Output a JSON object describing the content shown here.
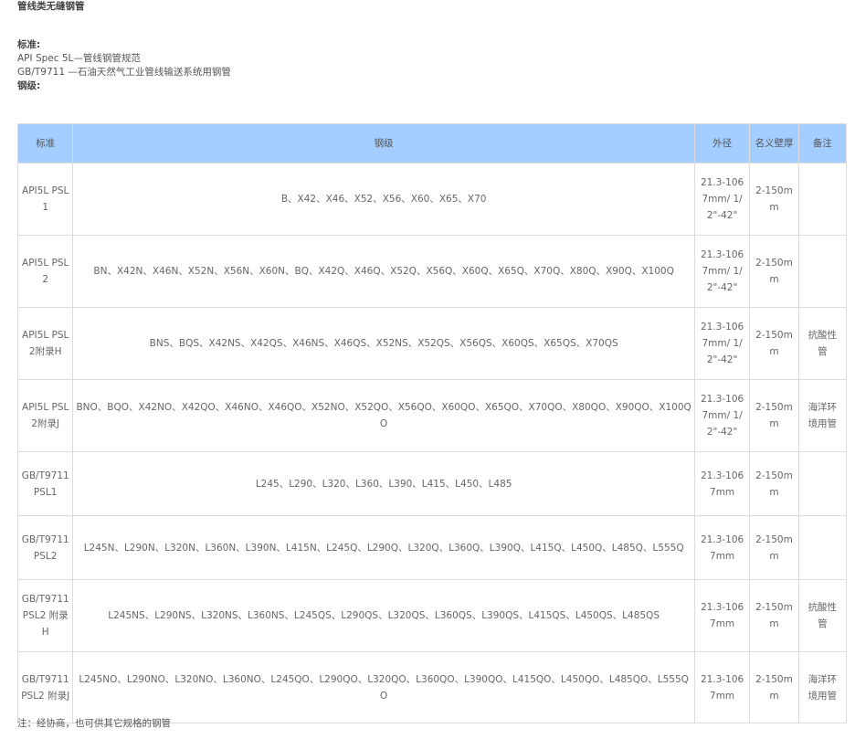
{
  "page": {
    "title": "管线类无缝钢管",
    "standard_label": "标准:",
    "standards": [
      "API Spec 5L—管线钢管规范",
      "GB/T9711 —石油天然气工业管线输送系统用钢管"
    ],
    "grade_label": "钢级:"
  },
  "table": {
    "headers": [
      "标准",
      "钢级",
      "外径",
      "名义壁厚",
      "备注"
    ],
    "rows": [
      {
        "std": "API5L PSL1",
        "grade": "B、X42、X46、X52、X56、X60、X65、X70",
        "od": "21.3-1067mm/ 1/2\"-42\"",
        "wt": "2-150mm",
        "note": ""
      },
      {
        "std": "API5L PSL2",
        "grade": "BN、X42N、X46N、X52N、X56N、X60N、BQ、X42Q、X46Q、X52Q、X56Q、X60Q、X65Q、X70Q、X80Q、X90Q、X100Q",
        "od": "21.3-1067mm/ 1/2\"-42\"",
        "wt": "2-150mm",
        "note": ""
      },
      {
        "std": "API5L PSL2附录H",
        "grade": "BNS、BQS、X42NS、X42QS、X46NS、X46QS、X52NS、X52QS、X56QS、X60QS、X65QS、X70QS",
        "od": "21.3-1067mm/ 1/2\"-42\"",
        "wt": "2-150mm",
        "note": "抗酸性管"
      },
      {
        "std": "API5L PSL2附录J",
        "grade": "BNO、BQO、X42NO、X42QO、X46NO、X46QO、X52NO、X52QO、X56QO、X60QO、X65QO、X70QO、X80QO、X90QO、X100QO",
        "od": "21.3-1067mm/ 1/2\"-42\"",
        "wt": "2-150mm",
        "note": "海洋环境用管"
      },
      {
        "std": "GB/T9711 PSL1",
        "grade": "L245、L290、L320、L360、L390、L415、L450、L485",
        "od": "21.3-1067mm",
        "wt": "2-150mm",
        "note": ""
      },
      {
        "std": "GB/T9711 PSL2",
        "grade": "L245N、L290N、L320N、L360N、L390N、L415N、L245Q、L290Q、L320Q、L360Q、L390Q、L415Q、L450Q、L485Q、L555Q",
        "od": "21.3-1067mm",
        "wt": "2-150mm",
        "note": ""
      },
      {
        "std": "GB/T9711 PSL2 附录H",
        "grade": "L245NS、L290NS、L320NS、L360NS、L245QS、L290QS、L320QS、L360QS、L390QS、L415QS、L450QS、L485QS",
        "od": "21.3-1067mm",
        "wt": "2-150mm",
        "note": "抗酸性管"
      },
      {
        "std": "GB/T9711 PSL2 附录J",
        "grade": "L245NO、L290NO、L320NO、L360NO、L245QO、L290QO、L320QO、L360QO、L390QO、L415QO、L450QO、L485QO、L555QO",
        "od": "21.3-1067mm",
        "wt": "2-150mm",
        "note": "海洋环境用管"
      }
    ]
  },
  "footnote": "注：经协商，也可供其它规格的钢管",
  "colors": {
    "header_bg": "#a3ceff",
    "border": "#dcdcdc",
    "text": "#666666"
  }
}
